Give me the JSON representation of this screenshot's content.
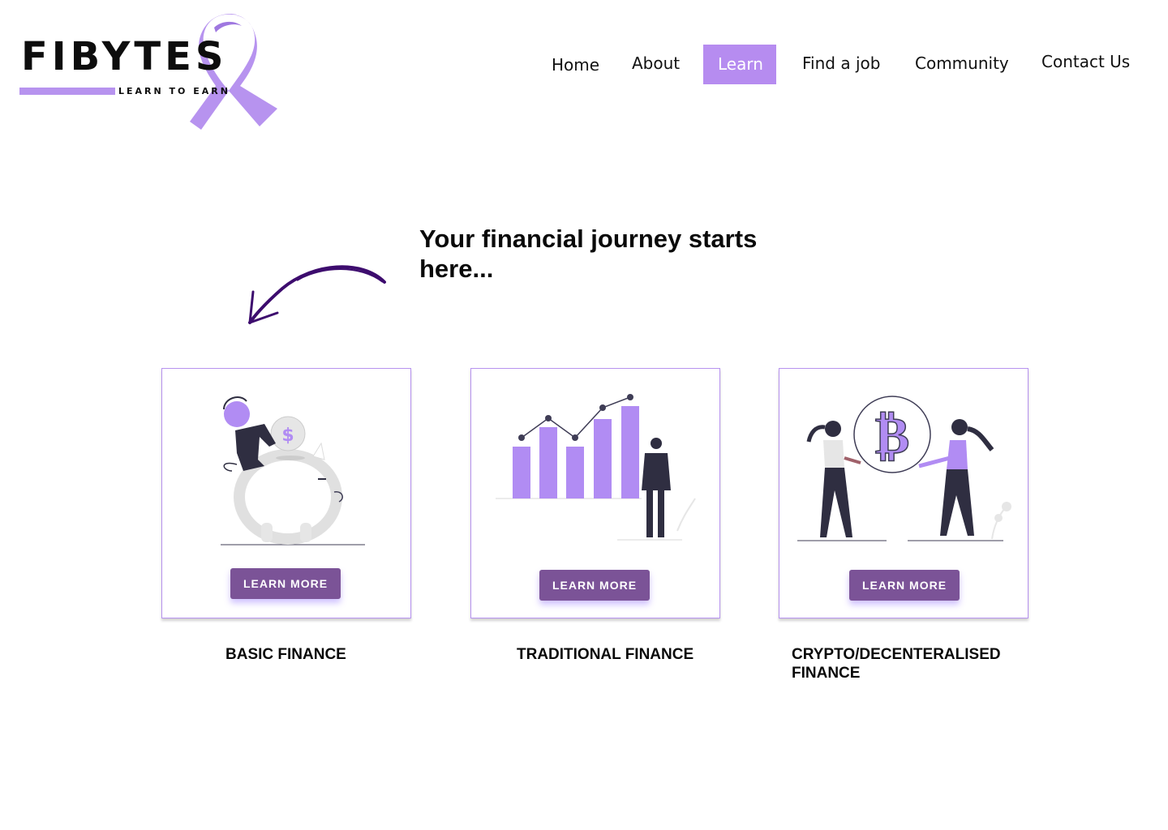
{
  "brand": {
    "name": "FIBYTES",
    "tagline": "LEARN TO EARN",
    "accent": "#b793ef",
    "button_color": "#7b5397",
    "icon": "ribbon-icon"
  },
  "nav": {
    "items": [
      {
        "label": "Home",
        "active": false
      },
      {
        "label": "About",
        "active": false
      },
      {
        "label": "Learn",
        "active": true
      },
      {
        "label": "Find a job",
        "active": false
      },
      {
        "label": "Community",
        "active": false
      },
      {
        "label": "Contact Us",
        "active": false
      }
    ]
  },
  "hero": {
    "title": "Your financial journey starts here...",
    "icon": "curved-arrow-icon"
  },
  "cards": [
    {
      "button": "LEARN MORE",
      "label": "BASIC FINANCE",
      "illustration": "piggy-bank-illustration"
    },
    {
      "button": "LEARN MORE",
      "label": "TRADITIONAL FINANCE",
      "illustration": "bar-chart-illustration"
    },
    {
      "button": "LEARN MORE",
      "label": "CRYPTO/DECENTERALISED FINANCE",
      "illustration": "bitcoin-exchange-illustration"
    }
  ]
}
